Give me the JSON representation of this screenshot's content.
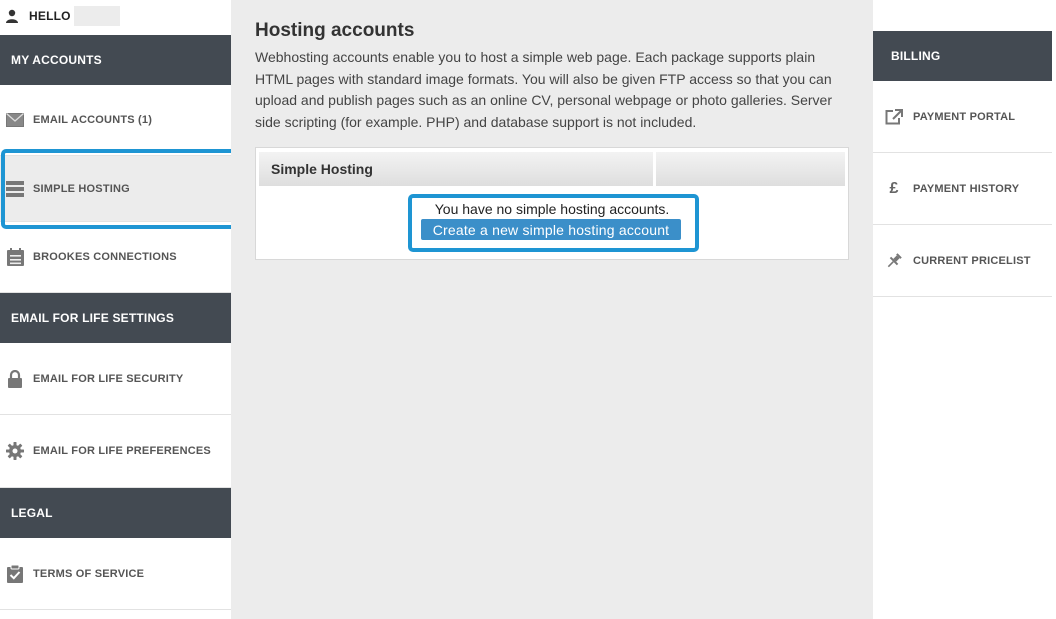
{
  "header": {
    "greeting": "HELLO"
  },
  "left_sidebar": {
    "sections": [
      {
        "title": "MY ACCOUNTS",
        "items": [
          {
            "label": "EMAIL ACCOUNTS (1)",
            "icon": "envelope-icon"
          },
          {
            "label": "SIMPLE HOSTING",
            "icon": "server-icon",
            "active": true
          },
          {
            "label": "BROOKES CONNECTIONS",
            "icon": "calendar-list-icon"
          }
        ]
      },
      {
        "title": "EMAIL FOR LIFE SETTINGS",
        "items": [
          {
            "label": "EMAIL FOR LIFE SECURITY",
            "icon": "lock-icon"
          },
          {
            "label": "EMAIL FOR LIFE PREFERENCES",
            "icon": "gear-icon"
          }
        ]
      },
      {
        "title": "LEGAL",
        "items": [
          {
            "label": "TERMS OF SERVICE",
            "icon": "clipboard-check-icon"
          }
        ]
      }
    ]
  },
  "main": {
    "title": "Hosting accounts",
    "description": "Webhosting accounts enable you to host a simple web page. Each package supports plain HTML pages with standard image formats. You will also be given FTP access so that you can upload and publish pages such as an online CV, personal webpage or photo galleries. Server side scripting (for example. PHP) and database support is not included.",
    "table": {
      "header": "Simple Hosting",
      "empty_message": "You have no simple hosting accounts.",
      "create_button": "Create a new simple hosting account"
    }
  },
  "right_sidebar": {
    "title": "BILLING",
    "items": [
      {
        "label": "PAYMENT PORTAL",
        "icon": "external-link-icon"
      },
      {
        "label": "PAYMENT HISTORY",
        "icon": "pound-sign-icon",
        "glyph": "£"
      },
      {
        "label": "CURRENT PRICELIST",
        "icon": "pushpin-icon"
      }
    ]
  },
  "colors": {
    "section_header_bg": "#434a52",
    "main_bg": "#ececec",
    "highlight_border": "#1e95d3",
    "button_bg": "#3b8fc9"
  }
}
